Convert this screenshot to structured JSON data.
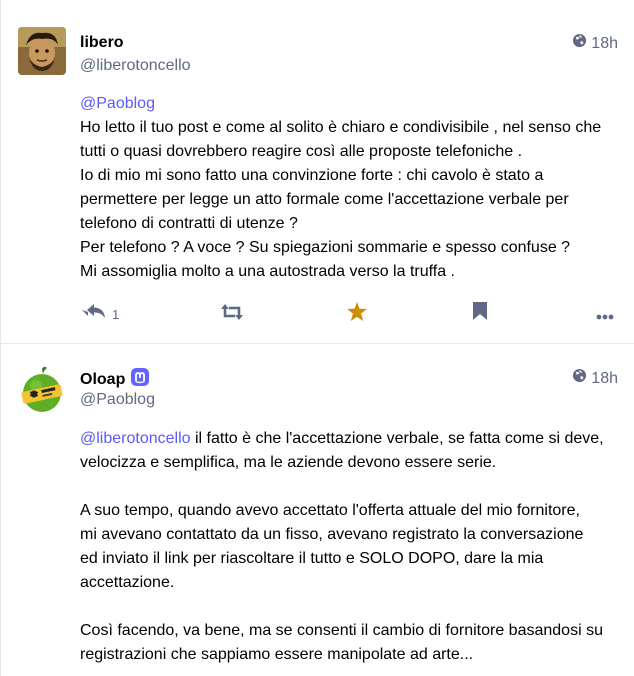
{
  "colors": {
    "mention": "#595aff",
    "muted": "#606984",
    "star_active": "#ca8f04",
    "mastodon_badge": "#6364ff"
  },
  "posts": [
    {
      "author_name": "libero",
      "author_handle": "@liberotoncello",
      "time": "18h",
      "visibility_icon": "globe-icon",
      "content_lines": [
        "@Paoblog",
        "Ho letto il tuo post e come al solito è chiaro e condivisibile , nel senso che",
        "tutti o quasi dovrebbero reagire così alle proposte telefoniche .",
        "Io di mio mi sono fatto una convinzione forte : chi cavolo è stato a",
        "permettere per legge un atto formale come l'accettazione verbale per",
        "telefono di contratti di utenze ?",
        "Per telefono ? A voce ? Su spiegazioni sommarie e spesso confuse ?",
        "Mi assomiglia molto a una autostrada verso la truffa ."
      ],
      "reply_count": "1"
    },
    {
      "author_name": "Oloap",
      "author_handle": "@Paoblog",
      "time": "18h",
      "visibility_icon": "globe-icon",
      "para1_mention": "@liberotoncello",
      "para1_line1_rest": " il fatto è che l'accettazione verbale, se fatta come si deve,",
      "para1_line2": "velocizza e semplifica, ma le aziende devono essere serie.",
      "para2_lines": [
        "A suo tempo, quando avevo accettato l'offerta attuale del mio fornitore,",
        "mi avevano contattato da un fisso, avevano registrato la conversazione",
        "ed inviato il link per riascoltare il tutto e SOLO DOPO, dare la mia",
        "accettazione."
      ],
      "para3_lines": [
        "Così facendo, va bene, ma se consenti il cambio di fornitore basandosi su",
        "registrazioni che sappiamo essere manipolate ad arte..."
      ]
    }
  ]
}
